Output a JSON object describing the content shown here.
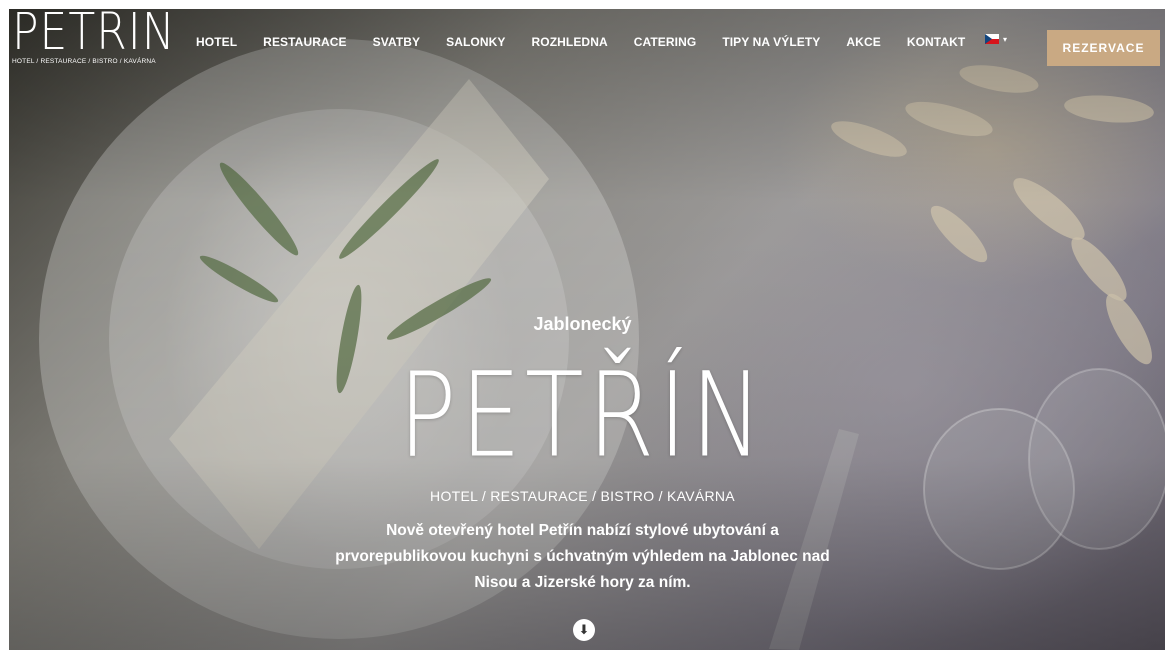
{
  "header": {
    "logo_word": "PETŘÍN",
    "logo_tagline": "HOTEL / RESTAURACE / BISTRO / KAVÁRNA"
  },
  "nav": {
    "items": [
      "HOTEL",
      "RESTAURACE",
      "SVATBY",
      "SALONKY",
      "ROZHLEDNA",
      "CATERING",
      "TIPY NA VÝLETY",
      "AKCE",
      "KONTAKT"
    ]
  },
  "language": {
    "icon": "czech-flag-icon",
    "chevron_icon": "chevron-down-icon"
  },
  "reserve_button": {
    "label": "REZERVACE",
    "color": "#c9a983"
  },
  "hero": {
    "kicker": "Jablonecký",
    "title": "PETŘÍN",
    "subtitle": "HOTEL / RESTAURACE / BISTRO / KAVÁRNA",
    "description_lines": [
      "Nově otevřený hotel Petřín nabízí stylové ubytování a",
      "prvorepublikovou kuchyni s úchvatným výhledem na Jablonec nad",
      "Nisou a Jizerské hory za ním."
    ],
    "scroll_icon": "arrow-down-circle-icon"
  }
}
